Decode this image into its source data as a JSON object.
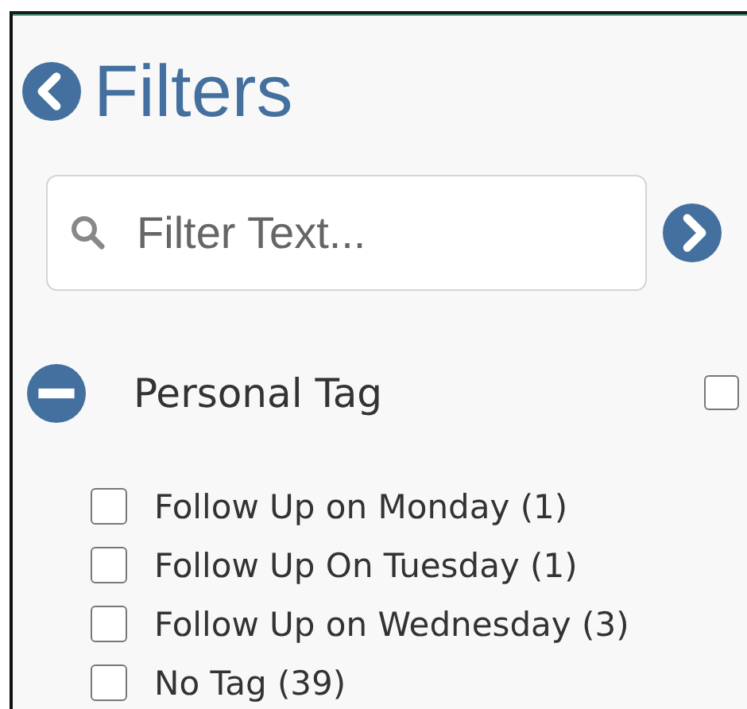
{
  "header": {
    "title": "Filters"
  },
  "search": {
    "placeholder": "Filter Text..."
  },
  "group": {
    "label": "Personal Tag",
    "expanded": true,
    "checked": false,
    "items": [
      {
        "label": "Follow Up on Monday (1)",
        "checked": false
      },
      {
        "label": "Follow Up On Tuesday (1)",
        "checked": false
      },
      {
        "label": "Follow Up on Wednesday (3)",
        "checked": false
      },
      {
        "label": "No Tag (39)",
        "checked": false
      }
    ]
  }
}
